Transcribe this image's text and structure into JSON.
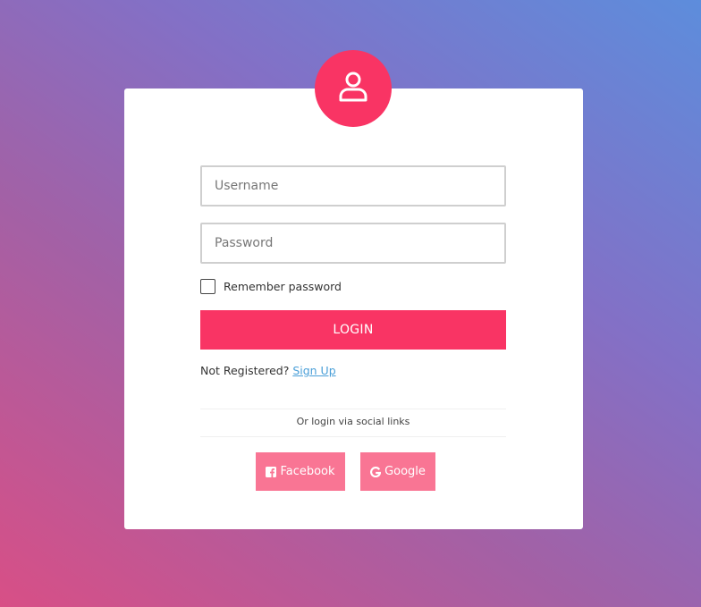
{
  "login_form": {
    "username_placeholder": "Username",
    "password_placeholder": "Password",
    "remember_label": "Remember password",
    "login_button": "LOGIN",
    "not_registered_text": "Not Registered?",
    "signup_link": "Sign Up",
    "social_text": "Or login via social links",
    "facebook_button": "Facebook",
    "google_button": "Google"
  },
  "icons": {
    "avatar": "user-icon",
    "facebook": "facebook-icon",
    "google": "google-icon"
  },
  "colors": {
    "accent": "#f93464",
    "social_button": "#f97594",
    "link": "#4a9fd8",
    "card": "#ffffff"
  }
}
